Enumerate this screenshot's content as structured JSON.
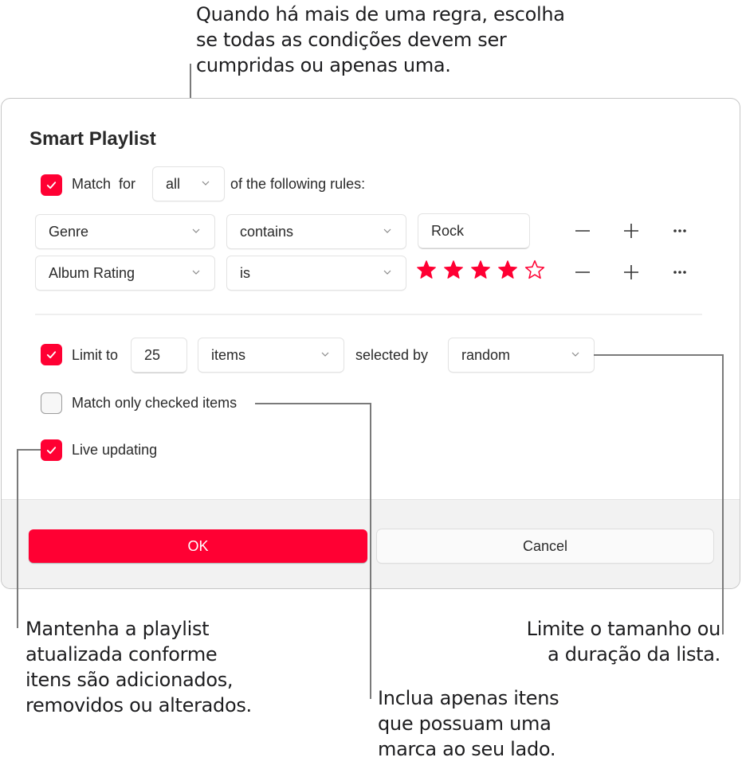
{
  "callouts": {
    "match_rule": "Quando há mais de uma regra, escolha\nse todas as condições devem ser\ncumpridas ou apenas uma.",
    "live_updating": "Mantenha a playlist\natualizada conforme\nitens são adicionados,\nremovidos ou alterados.",
    "checked_items": "Inclua apenas itens\nque possuam uma\nmarca ao seu lado.",
    "limit": "Limite o tamanho ou\na duração da lista."
  },
  "dialog": {
    "title": "Smart Playlist",
    "match": {
      "checked": true,
      "label_prefix": "Match  for",
      "mode": "all",
      "label_suffix": "of the following rules:"
    },
    "rules": [
      {
        "field": "Genre",
        "operator": "contains",
        "value": "Rock"
      },
      {
        "field": "Album Rating",
        "operator": "is",
        "rating": 4,
        "rating_max": 5
      }
    ],
    "rule_actions": {
      "remove_icon": "minus-icon",
      "add_icon": "plus-icon",
      "more_icon": "ellipsis-icon"
    },
    "limit": {
      "checked": true,
      "label": "Limit to",
      "count": "25",
      "unit": "items",
      "selected_by_label": "selected by",
      "selected_by": "random"
    },
    "match_only_checked": {
      "checked": false,
      "label": "Match only checked items"
    },
    "live_updating": {
      "checked": true,
      "label": "Live updating"
    },
    "buttons": {
      "ok": "OK",
      "cancel": "Cancel"
    }
  },
  "colors": {
    "accent": "#ff0033",
    "footer": "#f2f2f2",
    "leader": "#7a7a7a"
  }
}
